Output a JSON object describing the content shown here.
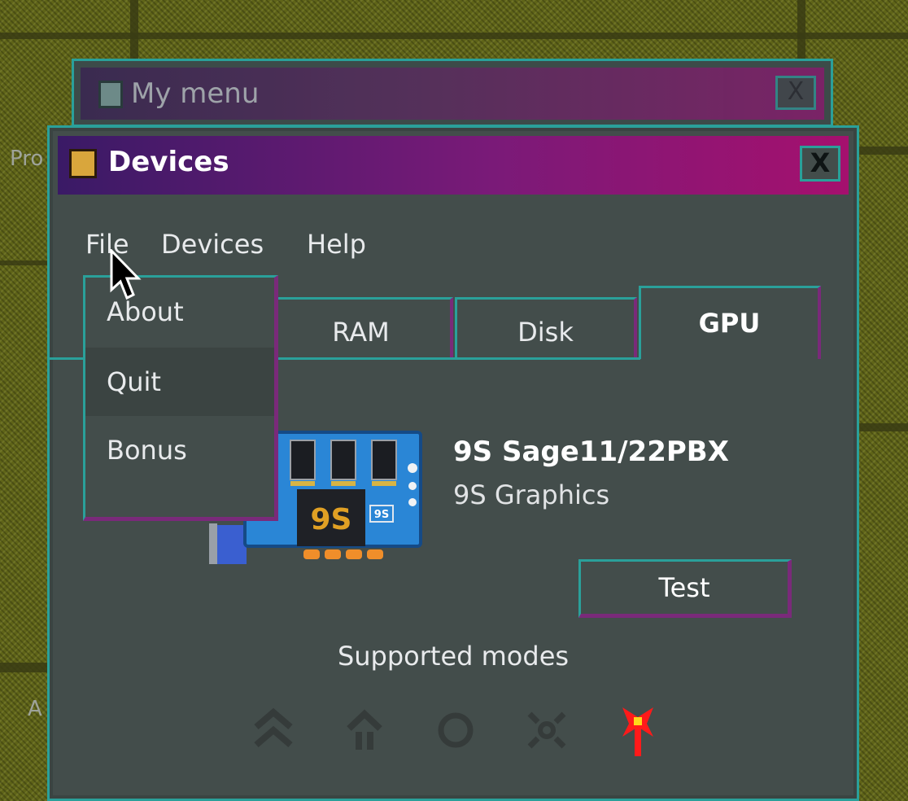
{
  "desktop": {
    "labels": [
      "Pro",
      "A"
    ]
  },
  "back_window": {
    "title": "My menu",
    "close_label": "X"
  },
  "window": {
    "title": "Devices",
    "close_label": "X",
    "menubar": [
      {
        "label": "File"
      },
      {
        "label": "Devices"
      },
      {
        "label": "Help"
      }
    ],
    "file_menu": [
      {
        "label": "About"
      },
      {
        "label": "Quit"
      },
      {
        "label": "Bonus"
      }
    ],
    "tabs": [
      {
        "label": "RAM",
        "active": false
      },
      {
        "label": "Disk",
        "active": false
      },
      {
        "label": "GPU",
        "active": true
      }
    ],
    "device": {
      "name": "9S Sage11/22PBX",
      "vendor": "9S Graphics",
      "card_logo": "9S",
      "card_badge": "9S",
      "icon": "graphics-card-icon"
    },
    "test_label": "Test",
    "modes_label": "Supported modes",
    "modes": [
      {
        "icon": "double-chevron-up-icon",
        "color": "#353b3a"
      },
      {
        "icon": "arrow-up-pillar-icon",
        "color": "#353b3a"
      },
      {
        "icon": "circle-icon",
        "color": "#353b3a"
      },
      {
        "icon": "crossed-circle-icon",
        "color": "#353b3a"
      },
      {
        "icon": "red-pin-icon",
        "color": "#ff1a1a"
      }
    ]
  },
  "colors": {
    "accent_border": "#2aa09a",
    "shadow_border": "#7a2a7a",
    "window_bg": "#434d4b",
    "title_gradient_start": "#3a1a66",
    "title_gradient_end": "#a5106e",
    "title_icon": "#d9a63c"
  }
}
